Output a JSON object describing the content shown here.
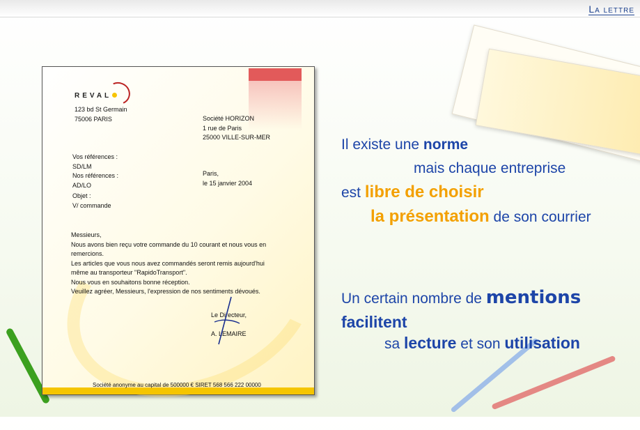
{
  "header": {
    "section_title": "La lettre"
  },
  "letter": {
    "company": "REVAL",
    "sender_address": [
      "123 bd St Germain",
      "75006 PARIS"
    ],
    "recipient": [
      "Société HORIZON",
      "1 rue de Paris",
      "25000 VILLE-SUR-MER"
    ],
    "refs": [
      {
        "label": "Vos références :",
        "value": "SD/LM"
      },
      {
        "label": "Nos références :",
        "value": "AD/LO"
      },
      {
        "label": "Objet :",
        "value": "V/ commande"
      }
    ],
    "place_date": [
      "Paris,",
      "le 15 janvier 2004"
    ],
    "body": [
      "Messieurs,",
      "Nous avons bien reçu votre commande du 10 courant et nous vous en",
      "remercions.",
      "Les articles que vous nous avez commandés seront remis aujourd'hui",
      "même au transporteur \"RapidoTransport\".",
      "Nous vous en souhaitons bonne réception.",
      "Veuillez agréer, Messieurs, l'expression de nos sentiments dévoués."
    ],
    "signature_title": "Le Directeur,",
    "signature_name": "A. LEMAIRE",
    "footer": "Société anonyme au capital de 500000 € SIRET 568 566 222 00000"
  },
  "text": {
    "p1": {
      "a": "Il existe une ",
      "a_b": "norme",
      "b": "mais chaque entreprise",
      "c": "est ",
      "c_o": "libre de choisir",
      "d_o": "la présentation",
      "d": " de son courrier"
    },
    "p2": {
      "a": "Un certain nombre de ",
      "a_big": "mentions",
      "b_b": "facilitent",
      "c": "sa ",
      "c_b": "lecture",
      "c2": " et son ",
      "c2_b": "utilisation"
    }
  },
  "colors": {
    "text_blue": "#1d45a8",
    "highlight_orange": "#f3a000",
    "letter_band": "#f5c500",
    "corner_red": "#e25a5a"
  }
}
